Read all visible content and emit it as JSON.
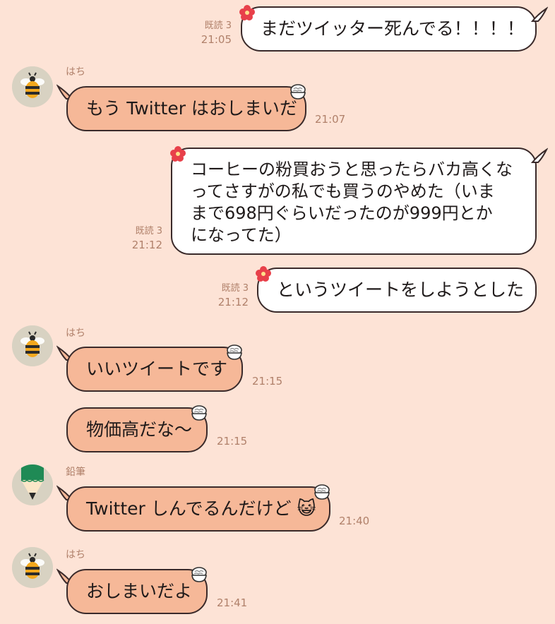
{
  "messages": [
    {
      "side": "me",
      "text": "まだツイッター死んでる！！！！",
      "read": "既読 3",
      "time": "21:05"
    },
    {
      "side": "other",
      "sender": "はち",
      "text": "もう Twitter はおしまいだ",
      "time": "21:07"
    },
    {
      "side": "me",
      "lines": [
        "コーヒーの粉買おうと思ったらバカ高くな",
        "ってさすがの私でも買うのやめた（いま",
        "まで698円ぐらいだったのが999円とか",
        "になってた）"
      ],
      "read": "既読 3",
      "time": "21:12"
    },
    {
      "side": "me",
      "text": "というツイートをしようとした",
      "read": "既読 3",
      "time": "21:12"
    },
    {
      "side": "other",
      "sender": "はち",
      "text": "いいツイートです",
      "time": "21:15"
    },
    {
      "side": "other",
      "text": "物価高だな〜",
      "time": "21:15"
    },
    {
      "side": "other",
      "sender": "鉛筆",
      "text": "Twitter しんでるんだけど",
      "emoji": "😺",
      "time": "21:40"
    },
    {
      "side": "other",
      "sender": "はち",
      "text": "おしまいだよ",
      "time": "21:41"
    }
  ],
  "icons": {
    "me_decoration": "hibiscus-icon",
    "other_decoration": "rice-bowl-icon",
    "avatar_bee": "bee-icon",
    "avatar_pencil": "pencil-icon"
  },
  "colors": {
    "background": "#fde3d6",
    "my_bubble": "#ffffff",
    "their_bubble": "#f6b898",
    "meta_text": "#b0806a"
  }
}
